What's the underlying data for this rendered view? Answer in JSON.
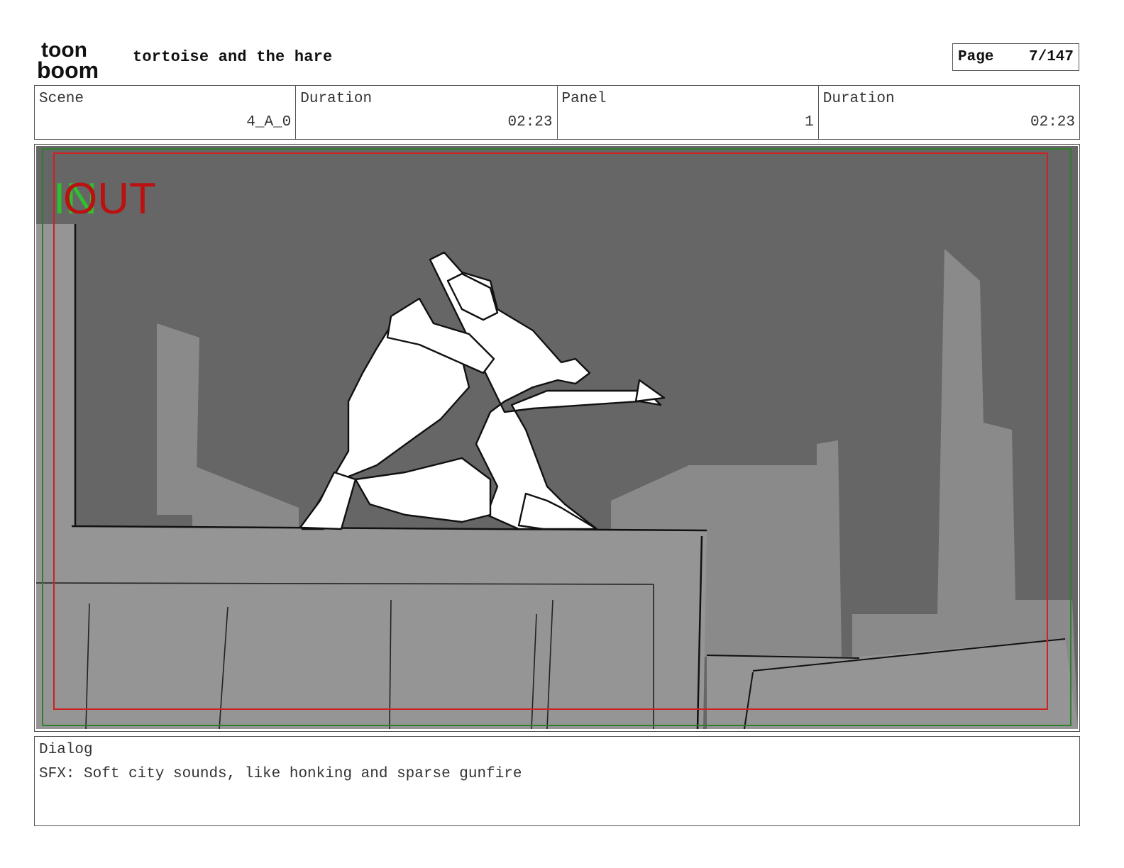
{
  "header": {
    "brand_logo": {
      "line1": "toon",
      "line2": "boom"
    },
    "project_title": "tortoise and the hare",
    "page_label": "Page",
    "page_value": "7/147"
  },
  "info": {
    "scene_label": "Scene",
    "scene_value": "4_A_0",
    "scene_duration_label": "Duration",
    "scene_duration_value": "02:23",
    "panel_label": "Panel",
    "panel_value": "1",
    "panel_duration_label": "Duration",
    "panel_duration_value": "02:23"
  },
  "panel": {
    "in_marker": "IN",
    "out_marker": "OUT",
    "colors": {
      "sky": "#666666",
      "buildings_far": "#8a8a8a",
      "rooftop": "#959595",
      "safe_frame": "#cc2222",
      "camera_frame": "#2f7d2f",
      "in_marker": "#2fbf2f",
      "out_marker": "#bb1111"
    }
  },
  "dialog": {
    "label": "Dialog",
    "text": "SFX: Soft city sounds, like honking and sparse gunfire"
  }
}
